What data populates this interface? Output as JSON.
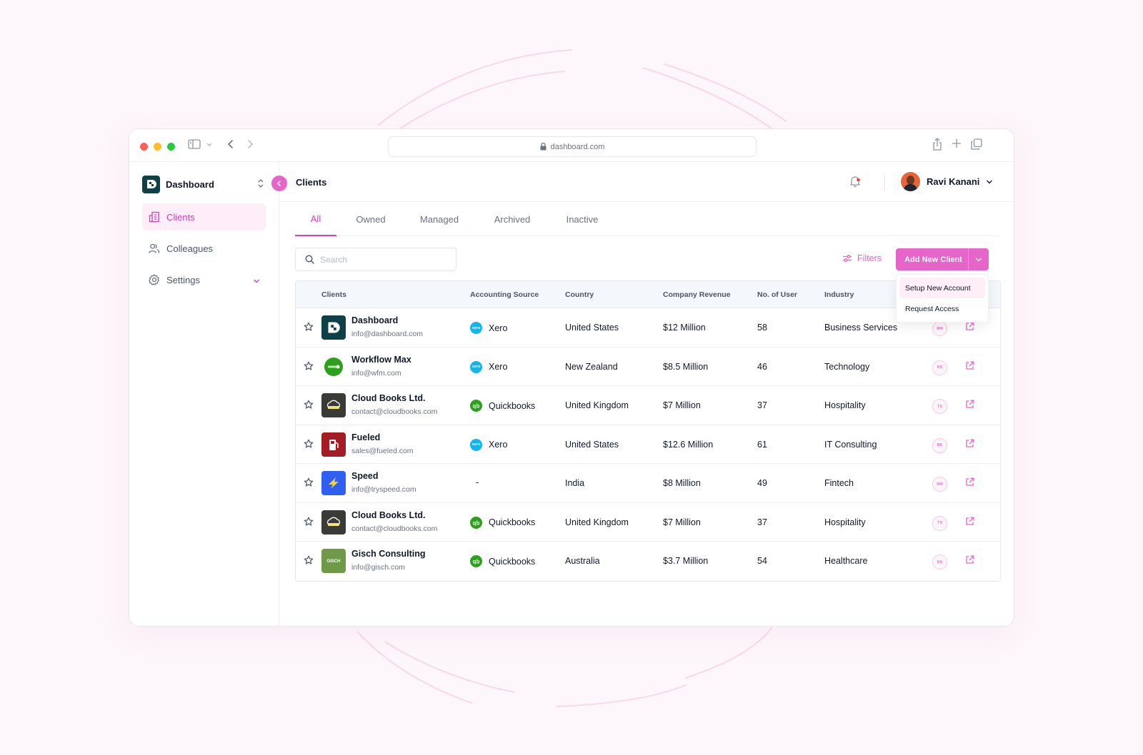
{
  "browser": {
    "url": "dashboard.com"
  },
  "brand": {
    "name": "Dashboard"
  },
  "sidebar": {
    "items": [
      {
        "label": "Clients",
        "icon": "building-icon",
        "active": true
      },
      {
        "label": "Colleagues",
        "icon": "users-icon",
        "active": false
      },
      {
        "label": "Settings",
        "icon": "gear-icon",
        "active": false
      }
    ]
  },
  "header": {
    "title": "Clients",
    "user_name": "Ravi Kanani"
  },
  "tabs": [
    "All",
    "Owned",
    "Managed",
    "Archived",
    "Inactive"
  ],
  "search": {
    "placeholder": "Search"
  },
  "toolbar": {
    "filters_label": "Filters",
    "add_label": "Add New Client"
  },
  "dropdown": {
    "items": [
      "Setup New Account",
      "Request Access"
    ]
  },
  "table": {
    "headers": {
      "clients": "Clients",
      "source": "Accounting Source",
      "country": "Country",
      "revenue": "Company Revenue",
      "users": "No. of User",
      "industry": "Industry"
    },
    "rows": [
      {
        "name": "Dashboard",
        "email": "info@dashboard.com",
        "source": "Xero",
        "country": "United States",
        "revenue": "$12 Million",
        "users": "58",
        "industry": "Business Services",
        "owner": "RM"
      },
      {
        "name": "Workflow Max",
        "email": "info@wfm.com",
        "source": "Xero",
        "country": "New Zealand",
        "revenue": "$8.5 Million",
        "users": "46",
        "industry": "Technology",
        "owner": "KS"
      },
      {
        "name": "Cloud Books Ltd.",
        "email": "contact@cloudbooks.com",
        "source": "Quickbooks",
        "country": "United Kingdom",
        "revenue": "$7 Million",
        "users": "37",
        "industry": "Hospitality",
        "owner": "TS"
      },
      {
        "name": "Fueled",
        "email": "sales@fueled.com",
        "source": "Xero",
        "country": "United States",
        "revenue": "$12.6 Million",
        "users": "61",
        "industry": "IT Consulting",
        "owner": "RK"
      },
      {
        "name": "Speed",
        "email": "info@tryspeed.com",
        "source": "-",
        "country": "India",
        "revenue": "$8 Million",
        "users": "49",
        "industry": "Fintech",
        "owner": "RM"
      },
      {
        "name": "Cloud Books Ltd.",
        "email": "contact@cloudbooks.com",
        "source": "Quickbooks",
        "country": "United Kingdom",
        "revenue": "$7 Million",
        "users": "37",
        "industry": "Hospitality",
        "owner": "TS"
      },
      {
        "name": "Gisch Consulting",
        "email": "info@gisch.com",
        "source": "Quickbooks",
        "country": "Australia",
        "revenue": "$3.7 Million",
        "users": "54",
        "industry": "Healthcare",
        "owner": "KS"
      }
    ]
  },
  "colors": {
    "accent": "#e665c9",
    "accent_text": "#d43fb2",
    "xero": "#13b5ea",
    "quickbooks": "#2ca01c"
  }
}
